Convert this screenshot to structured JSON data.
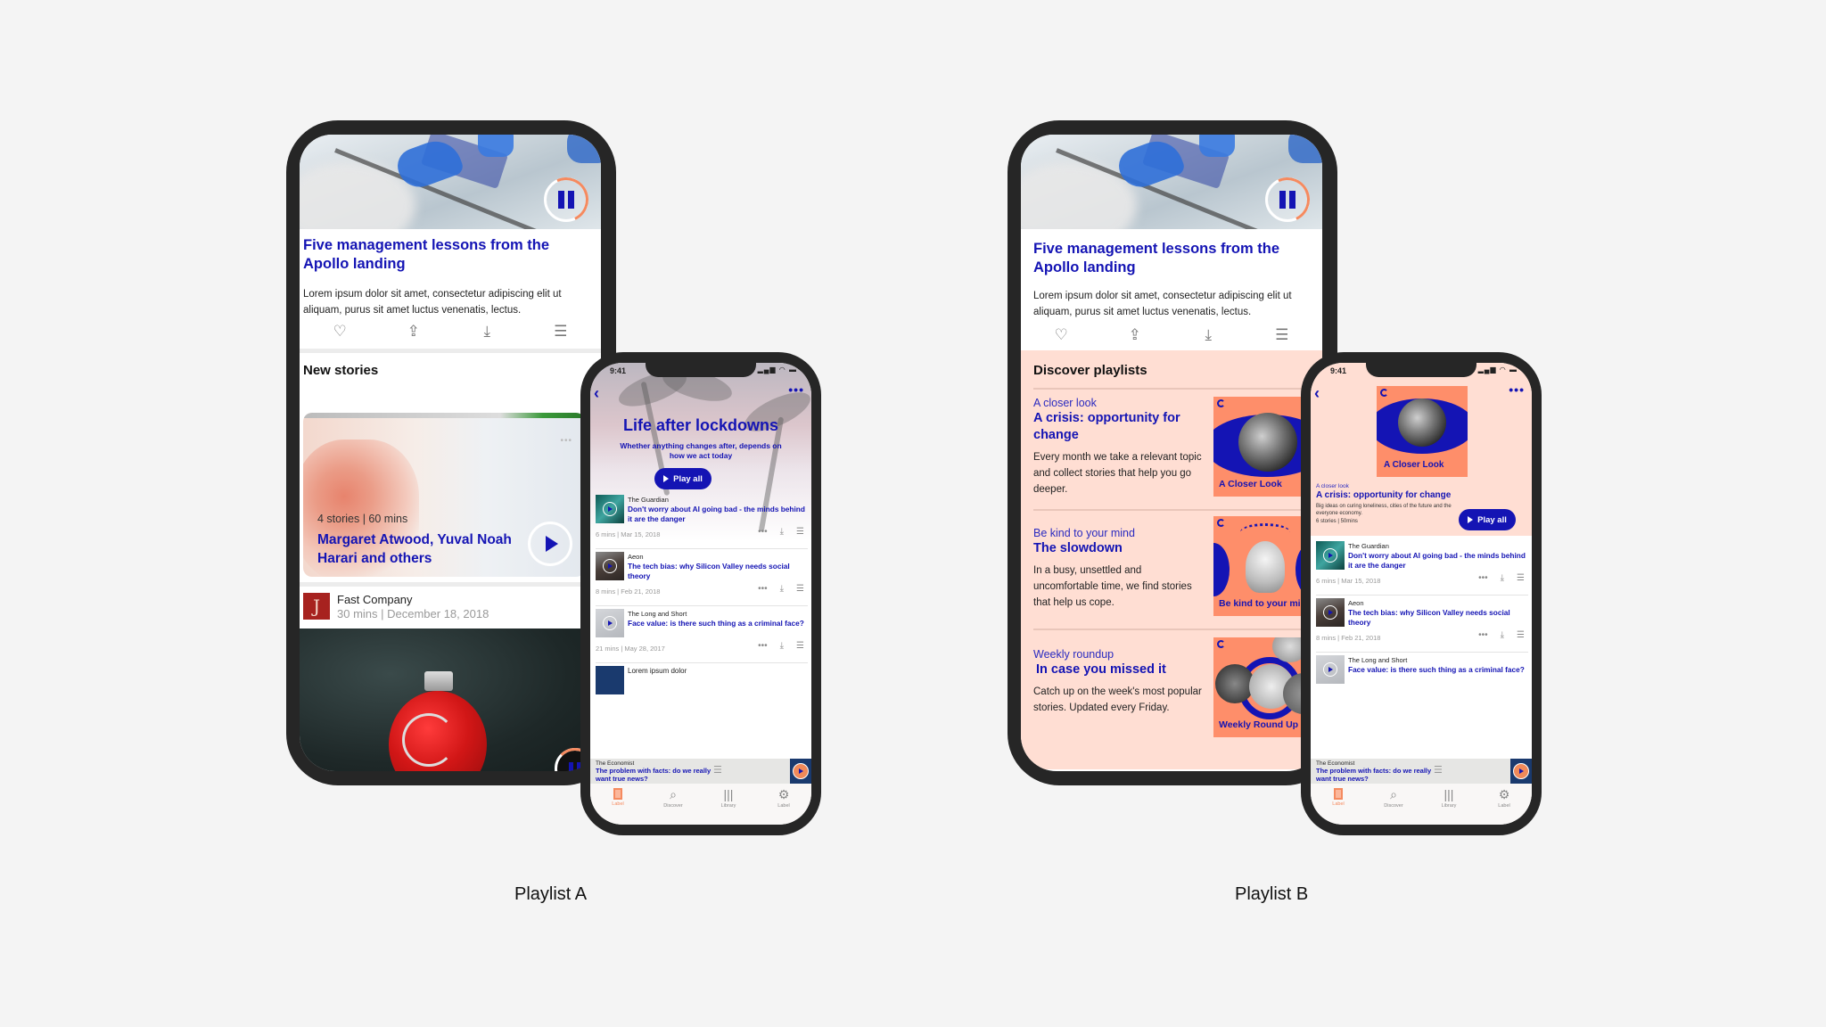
{
  "playlists": [
    {
      "label": "Playlist A",
      "big_phone": {
        "featured": {
          "title": "Five management lessons from the Apollo landing",
          "description": "Lorem ipsum dolor sit amet, consectetur adipiscing elit ut aliquam, purus sit amet luctus venenatis, lectus.",
          "action_icons": [
            "heart-icon",
            "share-icon",
            "download-icon",
            "add-to-queue-icon"
          ],
          "playback_state": "paused-icon"
        },
        "section_title": "New stories",
        "new_stories_card": {
          "meta": "4 stories | 60 mins",
          "title": "Margaret Atwood, Yuval Noah Harari and others"
        },
        "story": {
          "source": "Fast Company",
          "meta": "30 mins | December 18, 2018",
          "logo_glyph": "J"
        }
      },
      "small_phone": {
        "status_time": "9:41",
        "title": "Life after lockdowns",
        "subtitle": "Whether anything changes after, depends on how we act today",
        "play_all": "Play all",
        "stories": [
          {
            "source": "The Guardian",
            "title": "Don't worry about AI going bad - the minds behind it are the danger",
            "meta": "6 mins | Mar 15, 2018"
          },
          {
            "source": "Aeon",
            "title": "The tech bias: why Silicon Valley needs social theory",
            "meta": "8 mins | Feb 21, 2018"
          },
          {
            "source": "The Long and Short",
            "title": "Face value: is there such thing as a criminal face?",
            "meta": "21 mins | May 28, 2017"
          },
          {
            "source": "Lorem ipsum dolor",
            "title": "",
            "meta": ""
          }
        ],
        "mini_player": {
          "source": "The Economist",
          "title": "The problem with facts: do we really want true news?"
        },
        "tabs": [
          {
            "label": "Label",
            "icon": "book-icon",
            "active": true
          },
          {
            "label": "Discover",
            "icon": "search-icon",
            "active": false
          },
          {
            "label": "Library",
            "icon": "library-icon",
            "active": false
          },
          {
            "label": "Label",
            "icon": "gear-icon",
            "active": false
          }
        ]
      }
    },
    {
      "label": "Playlist B",
      "big_phone": {
        "featured": {
          "title": "Five management lessons from the Apollo landing",
          "description": "Lorem ipsum dolor sit amet, consectetur adipiscing elit ut aliquam, purus sit amet luctus venenatis, lectus.",
          "action_icons": [
            "heart-icon",
            "share-icon",
            "download-icon",
            "add-to-queue-icon"
          ],
          "playback_state": "paused-icon"
        },
        "section_title": "Discover playlists",
        "playlists": [
          {
            "kicker": "A closer look",
            "title": "A crisis: opportunity for change",
            "description": "Every month we take a relevant topic and collect stories that help you go deeper.",
            "art_caption": "A Closer Look"
          },
          {
            "kicker": "Be kind to your mind",
            "title": "The slowdown",
            "description": "In a busy, unsettled and uncomfortable time, we find stories that help us cope.",
            "art_caption": "Be kind to your mind"
          },
          {
            "kicker": "Weekly roundup",
            "title": "In case you missed it",
            "description": "Catch up on the week's most popular stories. Updated every Friday.",
            "art_caption": "Weekly Round Up"
          }
        ]
      },
      "small_phone": {
        "status_time": "9:41",
        "art_caption": "A Closer Look",
        "kicker": "A closer look",
        "title": "A crisis: opportunity for change",
        "description": "Big ideas on curing loneliness, cities of the future and the everyone economy.",
        "meta": "6 stories | 50mins",
        "play_all": "Play all",
        "stories": [
          {
            "source": "The Guardian",
            "title": "Don't worry about AI going bad - the minds behind it are the danger",
            "meta": "6 mins | Mar 15, 2018"
          },
          {
            "source": "Aeon",
            "title": "The tech bias: why Silicon Valley needs social theory",
            "meta": "8 mins | Feb 21, 2018"
          },
          {
            "source": "The Long and Short",
            "title": "Face value: is there such thing as a criminal face?",
            "meta": ""
          }
        ],
        "mini_player": {
          "source": "The Economist",
          "title": "The problem with facts: do we really want true news?"
        },
        "tabs": [
          {
            "label": "Label",
            "icon": "book-icon",
            "active": true
          },
          {
            "label": "Discover",
            "icon": "search-icon",
            "active": false
          },
          {
            "label": "Library",
            "icon": "library-icon",
            "active": false
          },
          {
            "label": "Label",
            "icon": "gear-icon",
            "active": false
          }
        ]
      }
    }
  ],
  "colors": {
    "brand_blue": "#1414b4",
    "accent_coral": "#f58a5f",
    "playlist_bg_peach": "#ffded3",
    "art_orange": "#fe8e6a",
    "page_bg": "#f4f4f4",
    "phone_frame": "#262626"
  },
  "icons": {
    "heart": "♡",
    "share": "⇪",
    "download": "⤓",
    "queue": "☰",
    "more": "•••",
    "back": "‹",
    "search": "⌕",
    "library": "|||",
    "gear": "⚙"
  }
}
